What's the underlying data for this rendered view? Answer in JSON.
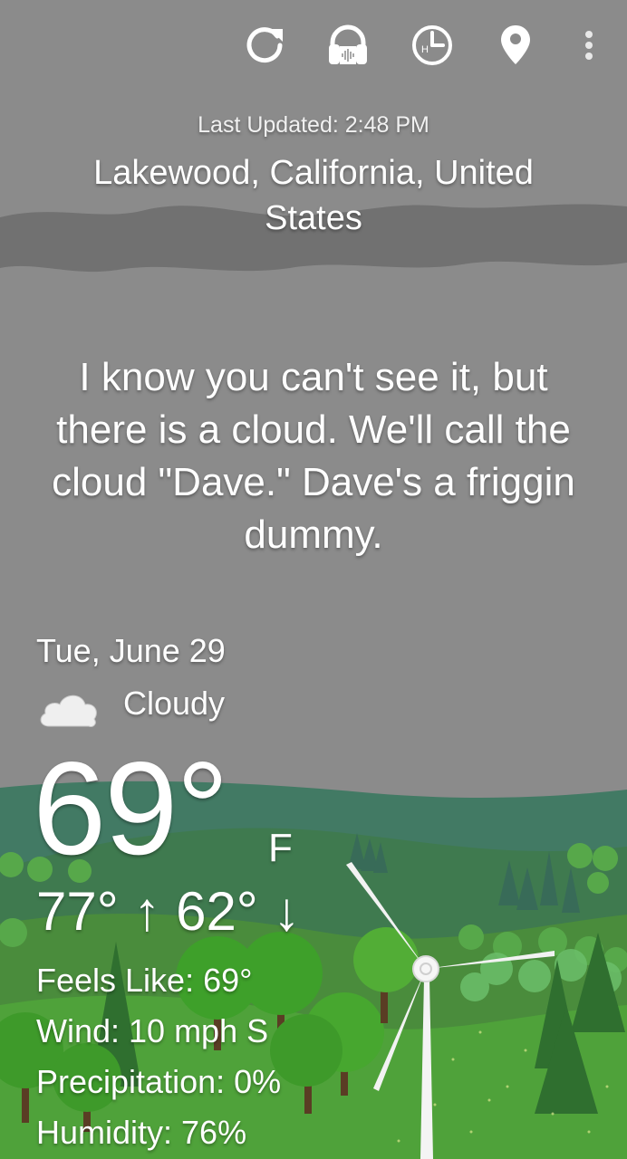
{
  "toolbar": {
    "refresh_icon": "refresh-icon",
    "audio_icon": "headphones-audio-icon",
    "hourly_icon": "hourly-clock-icon",
    "location_icon": "location-pin-icon",
    "menu_icon": "more-vert-icon",
    "hourly_letter": "H"
  },
  "header": {
    "last_updated": "Last Updated: 2:48 PM",
    "location": "Lakewood, California, United States"
  },
  "quote": "I know you can't see it, but there is a cloud. We'll call the cloud \"Dave.\" Dave's a friggin dummy.",
  "forecast": {
    "date": "Tue, June 29",
    "condition": "Cloudy",
    "condition_icon": "cloud-icon",
    "temperature": "69°",
    "unit": "F",
    "hi_lo": "77° ↑ 62° ↓",
    "feels_like": "Feels Like: 69°",
    "wind": "Wind: 10 mph S",
    "precipitation": "Precipitation: 0%",
    "humidity": "Humidity: 76%"
  },
  "colors": {
    "sky": "#8a8a8a",
    "cloud_band": "#6e6e6e",
    "far_hills": "#3f7762",
    "grass": "#4a9a34",
    "trees": "#3e9a2a"
  }
}
